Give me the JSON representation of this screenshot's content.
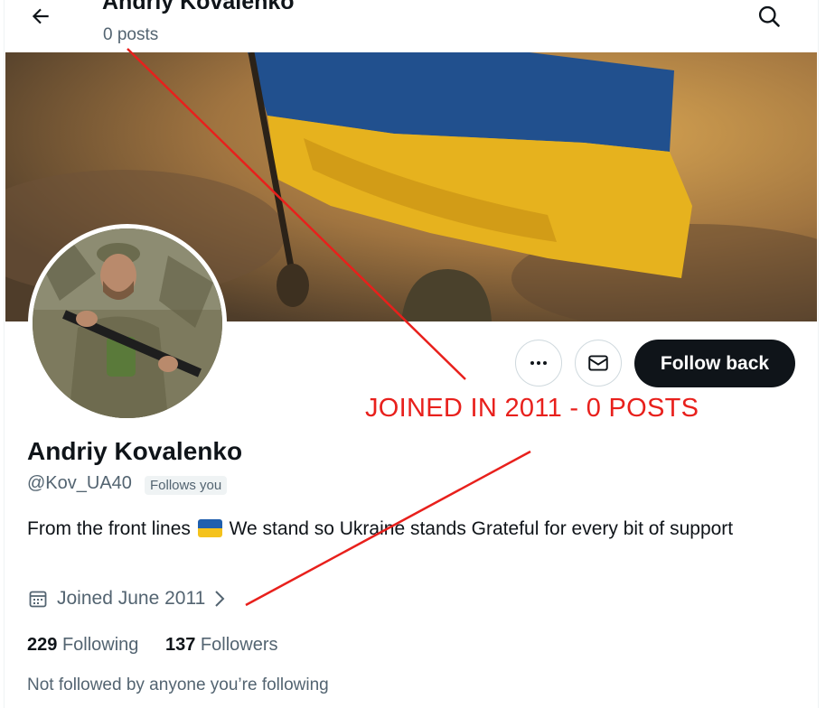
{
  "header": {
    "name": "Andriy Kovalenko",
    "posts": "0 posts",
    "back_icon": "arrow-left-icon",
    "search_icon": "search-icon"
  },
  "profile": {
    "name": "Andriy Kovalenko",
    "handle": "@Kov_UA40",
    "follows_you": "Follows you",
    "bio_part1": "From the front lines",
    "bio_part2": "We stand so Ukraine stands Grateful for every bit of support",
    "joined": "Joined June 2011",
    "following_count": "229",
    "following_label": "Following",
    "followers_count": "137",
    "followers_label": "Followers",
    "not_followed": "Not followed by anyone you’re following"
  },
  "actions": {
    "more_icon": "more-dots-icon",
    "message_icon": "envelope-icon",
    "follow_label": "Follow back"
  },
  "annotation": {
    "text": "JOINED IN 2011 - 0 POSTS",
    "color": "#e8201c"
  },
  "colors": {
    "flag_blue": "#1f5fae",
    "flag_yellow": "#f4c21c",
    "text_primary": "#0f1419",
    "text_secondary": "#536471"
  }
}
